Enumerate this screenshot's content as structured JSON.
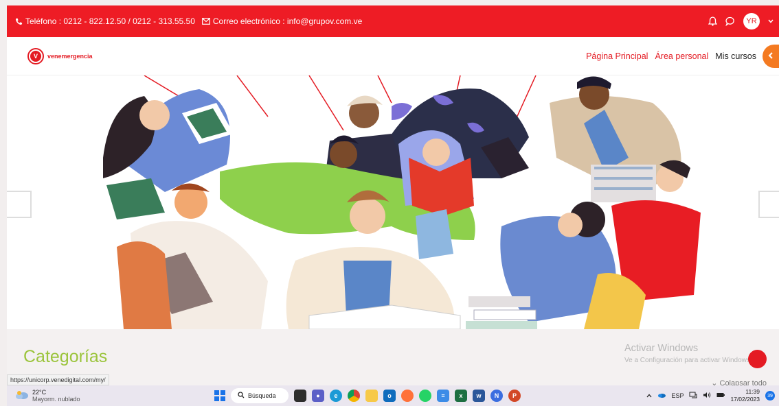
{
  "topbar": {
    "phone": "Teléfono : 0212 - 822.12.50 / 0212 - 313.55.50",
    "email": "Correo electrónico : info@grupov.com.ve",
    "user_initials": "YR"
  },
  "navbar": {
    "brand": "venemergencia",
    "logo_letter": "V",
    "links": [
      "Página Principal",
      "Área personal",
      "Mis cursos"
    ],
    "accent": "#e41b23"
  },
  "section": {
    "categories_title": "Categorías",
    "activate_title": "Activar Windows",
    "activate_sub": "Ve a Configuración para activar Windows.",
    "collapse_label": "Colapsar todo"
  },
  "status_url": "https://unicorp.venedigital.com/my/",
  "taskbar": {
    "temperature": "22°C",
    "weather": "Mayorm. nublado",
    "search_label": "Búsqueda",
    "language": "ESP",
    "time": "11:39",
    "date": "17/02/2023",
    "notification_count": "39"
  },
  "colors": {
    "brand_red": "#ee1c25",
    "category_green": "#9bc43c",
    "orange": "#f47a21"
  }
}
